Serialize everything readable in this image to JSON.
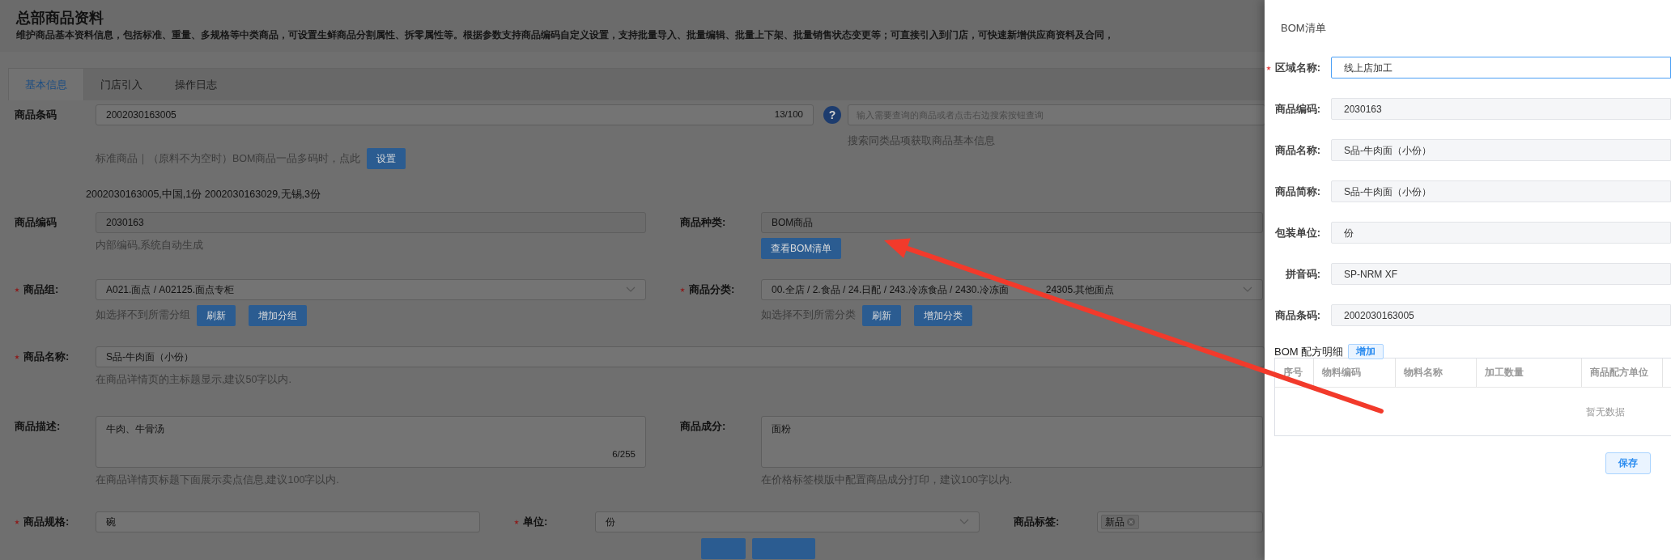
{
  "page": {
    "title": "总部商品资料",
    "description": "维护商品基本资料信息，包括标准、重量、多规格等中类商品，可设置生鲜商品分割属性、拆零属性等。根据参数支持商品编码自定义设置，支持批量导入、批量编辑、批量上下架、批量销售状态变更等；可直接引入到门店，可快速新增供应商资料及合同，"
  },
  "tabs": [
    {
      "label": "基本信息",
      "selected": true
    },
    {
      "label": "门店引入",
      "selected": false
    },
    {
      "label": "操作日志",
      "selected": false
    }
  ],
  "barcode_row": {
    "label": "商品条码",
    "value": "2002030163005",
    "counter": "13/100",
    "help_icon": "?",
    "search_placeholder": "输入需要查询的商品或者点击右边搜索按钮查询",
    "search_hint": "搜索同类品项获取商品基本信息",
    "hint": "标准商品｜（原料不为空时）BOM商品一品多码时，点此",
    "button": "设置"
  },
  "barcode_list": "2002030163005,中国,1份 2002030163029,无锡,3份",
  "form_rows": [
    [
      {
        "label": "商品编码",
        "required": false,
        "kind": "disabled",
        "value": "2030163",
        "hint": "内部编码,系统自动生成"
      },
      {
        "label": "商品种类:",
        "required": false,
        "kind": "disabled",
        "value": "BOM商品",
        "buttons": [
          "查看BOM清单"
        ]
      }
    ],
    [
      {
        "label": "商品组:",
        "required": true,
        "kind": "select",
        "value": "A021.面点 / A02125.面点专柜",
        "hint": "如选择不到所需分组",
        "buttons": [
          "刷新",
          "增加分组"
        ]
      },
      {
        "label": "商品分类:",
        "required": true,
        "kind": "select",
        "value": "00.全店 / 2.食品 / 24.日配 / 243.冷冻食品 / 2430.冷冻面",
        "value_continued": "24305.其他面点",
        "hint": "如选择不到所需分类",
        "buttons": [
          "刷新",
          "增加分类"
        ]
      }
    ],
    [
      {
        "label": "商品名称:",
        "required": true,
        "kind": "input",
        "value": "S品-牛肉面（小份）",
        "hint": "在商品详情页的主标题显示,建议50字以内."
      }
    ],
    [
      {
        "label": "商品描述:",
        "required": false,
        "kind": "textarea",
        "value": "牛肉、牛骨汤",
        "counter": "6/255",
        "hint": "在商品详情页标题下面展示卖点信息,建议100字以内."
      },
      {
        "label": "商品成分:",
        "required": false,
        "kind": "textarea",
        "value": "面粉",
        "hint": "在价格标签模版中配置商品成分打印，建议100字以内."
      }
    ],
    [
      {
        "label": "商品规格:",
        "required": true,
        "kind": "input",
        "value": "碗"
      },
      {
        "label": "单位:",
        "required": true,
        "kind": "select",
        "value": "份"
      },
      {
        "label": "商品标签:",
        "required": false,
        "kind": "tags",
        "tags": [
          "新品"
        ]
      }
    ]
  ],
  "drawer": {
    "title": "BOM清单",
    "fields": [
      {
        "label": "区域名称:",
        "required": true,
        "editable": true,
        "value": "线上店加工"
      },
      {
        "label": "商品编码:",
        "required": false,
        "editable": false,
        "value": "2030163"
      },
      {
        "label": "商品名称:",
        "required": false,
        "editable": false,
        "value": "S品-牛肉面（小份）"
      },
      {
        "label": "商品简称:",
        "required": false,
        "editable": false,
        "value": "S品-牛肉面（小份）"
      },
      {
        "label": "包装单位:",
        "required": false,
        "editable": false,
        "value": "份"
      },
      {
        "label": "拼音码:",
        "required": false,
        "editable": false,
        "value": "SP-NRM XF"
      },
      {
        "label": "商品条码:",
        "required": false,
        "editable": false,
        "value": "2002030163005"
      }
    ],
    "bom": {
      "title": "BOM 配方明细",
      "add_button": "增加",
      "columns": [
        "序号",
        "物料编码",
        "物料名称",
        "加工数量",
        "商品配方单位"
      ],
      "empty_text": "暂无数据"
    },
    "save_button": "保存"
  }
}
